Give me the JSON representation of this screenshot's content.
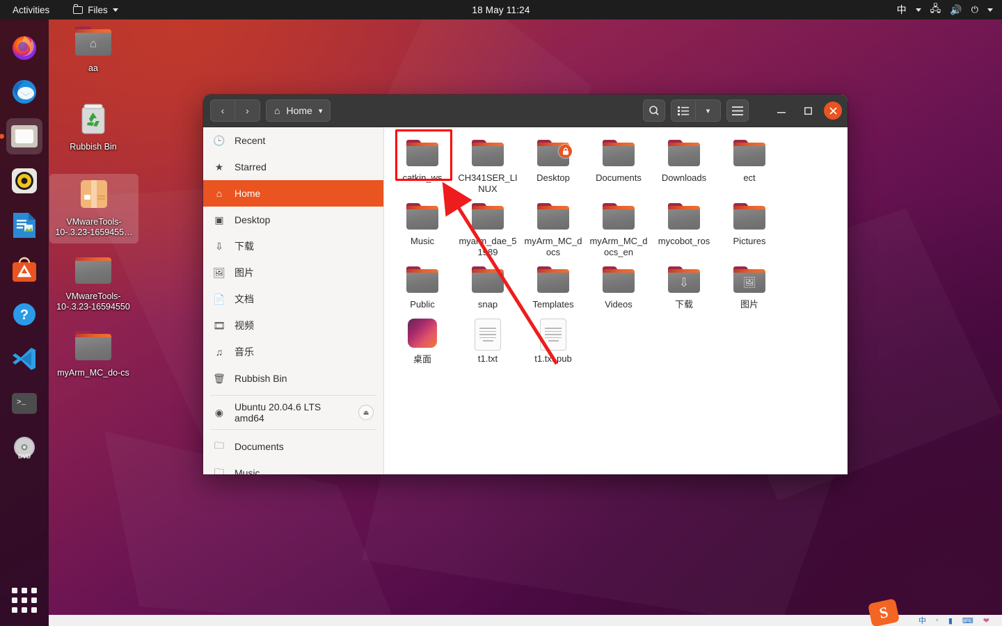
{
  "topbar": {
    "activities": "Activities",
    "app_menu": "Files",
    "app_icon": "folder-icon",
    "clock": "18 May  11:24",
    "indicators": [
      {
        "name": "input-method-indicator",
        "label": "中"
      },
      {
        "name": "network-icon",
        "label": ""
      },
      {
        "name": "volume-icon",
        "label": ""
      },
      {
        "name": "power-icon",
        "label": ""
      }
    ]
  },
  "dock": {
    "items": [
      {
        "name": "firefox",
        "icon": "firefox-icon",
        "active": false
      },
      {
        "name": "thunderbird",
        "icon": "thunderbird-icon",
        "active": false
      },
      {
        "name": "files",
        "icon": "files-icon",
        "active": true
      },
      {
        "name": "rhythmbox",
        "icon": "rhythmbox-icon",
        "active": false
      },
      {
        "name": "libreoffice-writer",
        "icon": "libreoffice-icon",
        "active": false
      },
      {
        "name": "ubuntu-software",
        "icon": "ubuntu-software-icon",
        "active": false
      },
      {
        "name": "help",
        "icon": "help-icon",
        "active": false
      },
      {
        "name": "vscode",
        "icon": "vscode-icon",
        "active": false
      },
      {
        "name": "terminal",
        "icon": "terminal-icon",
        "active": false
      },
      {
        "name": "dvd-drive",
        "icon": "dvd-icon",
        "active": false
      }
    ],
    "show_apps_label": "Show Applications"
  },
  "desktop_icons": [
    {
      "label": "aa",
      "type": "home-folder",
      "selected": false
    },
    {
      "label": "Rubbish Bin",
      "type": "trash",
      "selected": false
    },
    {
      "label": "VMwareTools-10-.3.23-1659455…",
      "type": "archive",
      "selected": true
    },
    {
      "label": "VMwareTools-10-.3.23-16594550",
      "type": "folder",
      "selected": false
    },
    {
      "label": "myArm_MC_do-cs",
      "type": "folder",
      "selected": false
    }
  ],
  "window": {
    "title": "Home",
    "toolbar": {
      "back": "‹",
      "forward": "›",
      "path_label": "Home",
      "path_icon": "home-icon",
      "path_caret": "▾",
      "search": "search-icon",
      "view_list": "list-view-icon",
      "view_caret": "▾",
      "menu": "hamburger-menu-icon",
      "minimize": "—",
      "maximize": "□",
      "close": "✕"
    },
    "sidebar": [
      {
        "label": "Recent",
        "icon": "clock-icon",
        "active": false,
        "type": "place"
      },
      {
        "label": "Starred",
        "icon": "star-icon",
        "active": false,
        "type": "place"
      },
      {
        "label": "Home",
        "icon": "home-icon",
        "active": true,
        "type": "place"
      },
      {
        "label": "Desktop",
        "icon": "desktop-icon",
        "active": false,
        "type": "place"
      },
      {
        "label": "下载",
        "icon": "download-icon",
        "active": false,
        "type": "place"
      },
      {
        "label": "图片",
        "icon": "image-icon",
        "active": false,
        "type": "place"
      },
      {
        "label": "文档",
        "icon": "document-icon",
        "active": false,
        "type": "place"
      },
      {
        "label": "视频",
        "icon": "video-icon",
        "active": false,
        "type": "place"
      },
      {
        "label": "音乐",
        "icon": "music-icon",
        "active": false,
        "type": "place"
      },
      {
        "label": "Rubbish Bin",
        "icon": "trash-icon",
        "active": false,
        "type": "place"
      },
      {
        "label": "Ubuntu 20.04.6 LTS amd64",
        "icon": "disc-icon",
        "active": false,
        "type": "device",
        "eject": "⏏"
      },
      {
        "label": "Documents",
        "icon": "folder-outline-icon",
        "active": false,
        "type": "bookmark"
      },
      {
        "label": "Music",
        "icon": "folder-outline-icon",
        "active": false,
        "type": "bookmark"
      }
    ],
    "files": [
      {
        "name": "catkin_ws",
        "type": "folder",
        "highlighted": true
      },
      {
        "name": "CH341SER_LINUX",
        "type": "folder",
        "highlighted": false
      },
      {
        "name": "Desktop",
        "type": "folder",
        "badge": "lock-icon",
        "highlighted": false
      },
      {
        "name": "Documents",
        "type": "folder",
        "highlighted": false
      },
      {
        "name": "Downloads",
        "type": "folder",
        "highlighted": false
      },
      {
        "name": "ect",
        "type": "folder",
        "highlighted": false
      },
      {
        "name": "Music",
        "type": "folder",
        "highlighted": false
      },
      {
        "name": "myarm_dae_51989",
        "type": "folder",
        "highlighted": false
      },
      {
        "name": "myArm_MC_docs",
        "type": "folder",
        "highlighted": false
      },
      {
        "name": "myArm_MC_docs_en",
        "type": "folder",
        "highlighted": false
      },
      {
        "name": "mycobot_ros",
        "type": "folder",
        "highlighted": false
      },
      {
        "name": "Pictures",
        "type": "folder",
        "highlighted": false
      },
      {
        "name": "Public",
        "type": "folder",
        "highlighted": false
      },
      {
        "name": "snap",
        "type": "folder",
        "highlighted": false
      },
      {
        "name": "Templates",
        "type": "folder",
        "highlighted": false
      },
      {
        "name": "Videos",
        "type": "folder",
        "highlighted": false
      },
      {
        "name": "下载",
        "type": "folder",
        "glyph": "download-icon",
        "highlighted": false
      },
      {
        "name": "图片",
        "type": "folder",
        "glyph": "image-icon",
        "highlighted": false
      },
      {
        "name": "桌面",
        "type": "image-thumbnail",
        "highlighted": false
      },
      {
        "name": "t1.txt",
        "type": "text-file",
        "highlighted": false
      },
      {
        "name": "t1.txt.pub",
        "type": "text-file",
        "highlighted": false
      }
    ]
  },
  "annotation": {
    "highlight_color": "#fe0000",
    "arrow_color": "#ee1c1c",
    "target": "catkin_ws"
  },
  "colors": {
    "accent": "#e95420",
    "titlebar": "#383838",
    "sidebar_bg": "#f6f5f4",
    "topbar_bg": "#1d1d1d"
  }
}
